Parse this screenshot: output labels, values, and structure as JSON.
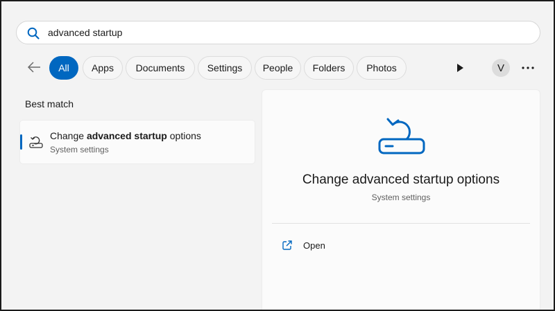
{
  "search": {
    "value": "advanced startup",
    "icon": "search-icon"
  },
  "filters": {
    "back_icon": "back-arrow-icon",
    "chips": [
      {
        "label": "All",
        "active": true
      },
      {
        "label": "Apps",
        "active": false
      },
      {
        "label": "Documents",
        "active": false
      },
      {
        "label": "Settings",
        "active": false
      },
      {
        "label": "People",
        "active": false
      },
      {
        "label": "Folders",
        "active": false
      },
      {
        "label": "Photos",
        "active": false
      }
    ],
    "play_icon": "play-icon",
    "avatar_initial": "V",
    "more_icon": "more-icon"
  },
  "results": {
    "section_label": "Best match",
    "best_match": {
      "title_prefix": "Change ",
      "title_bold": "advanced startup",
      "title_suffix": " options",
      "subtitle": "System settings",
      "icon": "recovery-icon"
    }
  },
  "detail": {
    "title": "Change advanced startup options",
    "subtitle": "System settings",
    "icon": "recovery-icon",
    "actions": [
      {
        "label": "Open",
        "icon": "open-external-icon"
      }
    ]
  },
  "colors": {
    "accent": "#0067c0",
    "background": "#f3f3f3",
    "pane": "#fbfbfb"
  }
}
